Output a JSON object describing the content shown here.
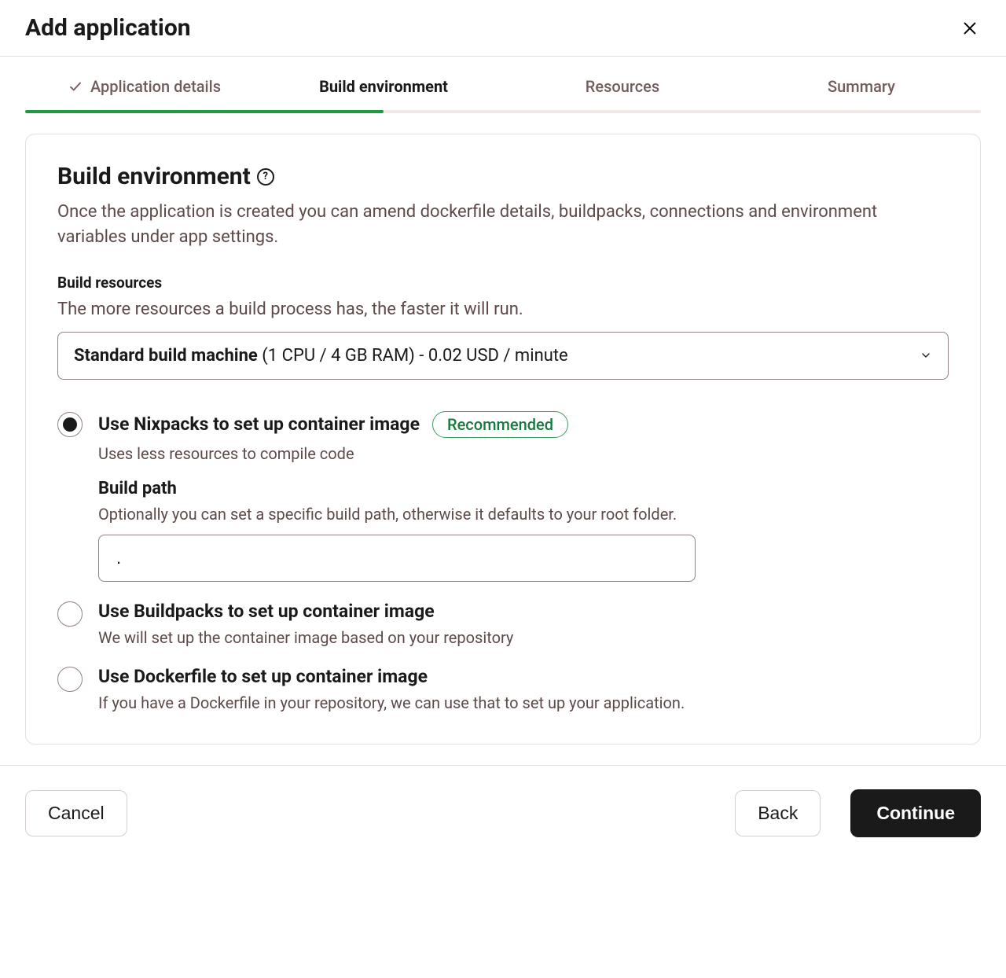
{
  "header": {
    "title": "Add application"
  },
  "tabs": {
    "items": [
      {
        "label": "Application details"
      },
      {
        "label": "Build environment"
      },
      {
        "label": "Resources"
      },
      {
        "label": "Summary"
      }
    ]
  },
  "section": {
    "title": "Build environment",
    "description": "Once the application is created you can amend dockerfile details, buildpacks, connections and environment variables under app settings."
  },
  "buildResources": {
    "title": "Build resources",
    "description": "The more resources a build process has, the faster it will run.",
    "selectedLabel": "Standard build machine ",
    "selectedDetail": "(1 CPU / 4 GB RAM) - 0.02 USD / minute"
  },
  "options": [
    {
      "title": "Use Nixpacks to set up container image",
      "badge": "Recommended",
      "description": "Uses less resources to compile code",
      "buildPath": {
        "title": "Build path",
        "description": "Optionally you can set a specific build path, otherwise it defaults to your root folder.",
        "value": "."
      }
    },
    {
      "title": "Use Buildpacks to set up container image",
      "description": "We will set up the container image based on your repository"
    },
    {
      "title": "Use Dockerfile to set up container image",
      "description": "If you have a Dockerfile in your repository, we can use that to set up your application."
    }
  ],
  "footer": {
    "cancel": "Cancel",
    "back": "Back",
    "continue": "Continue"
  }
}
